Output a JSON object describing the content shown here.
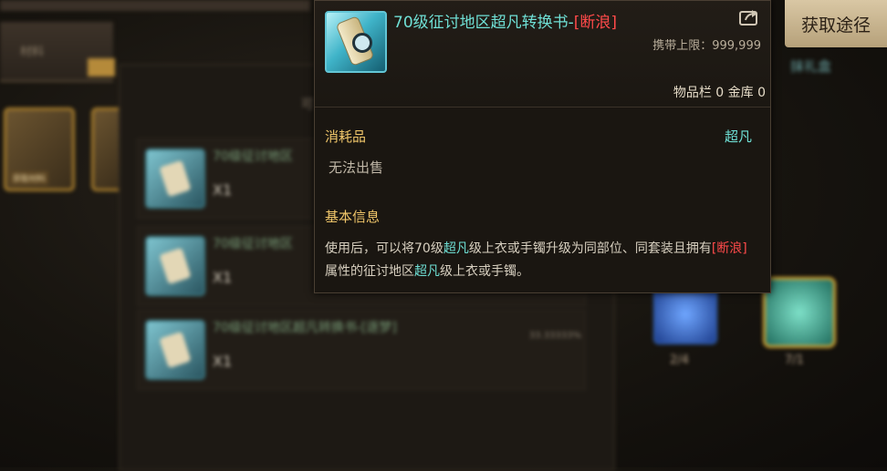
{
  "background": {
    "side_tab_label": "材料",
    "slot_label": "获取材料",
    "panel_title": "可",
    "right_title": "抹礼盒",
    "rows": [
      {
        "name": "70级征讨地区",
        "qty": "X1"
      },
      {
        "name": "70级征讨地区",
        "qty": "X1"
      },
      {
        "name": "70级征讨地区超凡转换书-[逐梦]",
        "qty": "X1",
        "percent": "33.33333%"
      }
    ],
    "gem_counts": [
      "2/4",
      "7/1"
    ]
  },
  "tooltip": {
    "icon": "scroll-with-lens-icon",
    "title_main": "70级征讨地区超凡转换书-",
    "title_tag": "[断浪]",
    "carry_limit": "携带上限：999,999",
    "inventory": "物品栏 0 金库 0",
    "category": "消耗品",
    "rarity": "超凡",
    "trade_status": "无法出售",
    "section_title": "基本信息",
    "desc": {
      "p1": "使用后，可以将70级",
      "p1_hl": "超凡",
      "p2": "级上衣或手镯升级为同部位、同套装且拥有",
      "p2_red": "[断浪]",
      "p3": "属性的征讨地区",
      "p3_hl": "超凡",
      "p4": "级上衣或手镯。"
    }
  },
  "get_button": {
    "label": "获取途径"
  },
  "colors": {
    "accent_cyan": "#6fe0d5",
    "accent_red": "#ff4a4a",
    "accent_gold": "#f0c66a"
  }
}
